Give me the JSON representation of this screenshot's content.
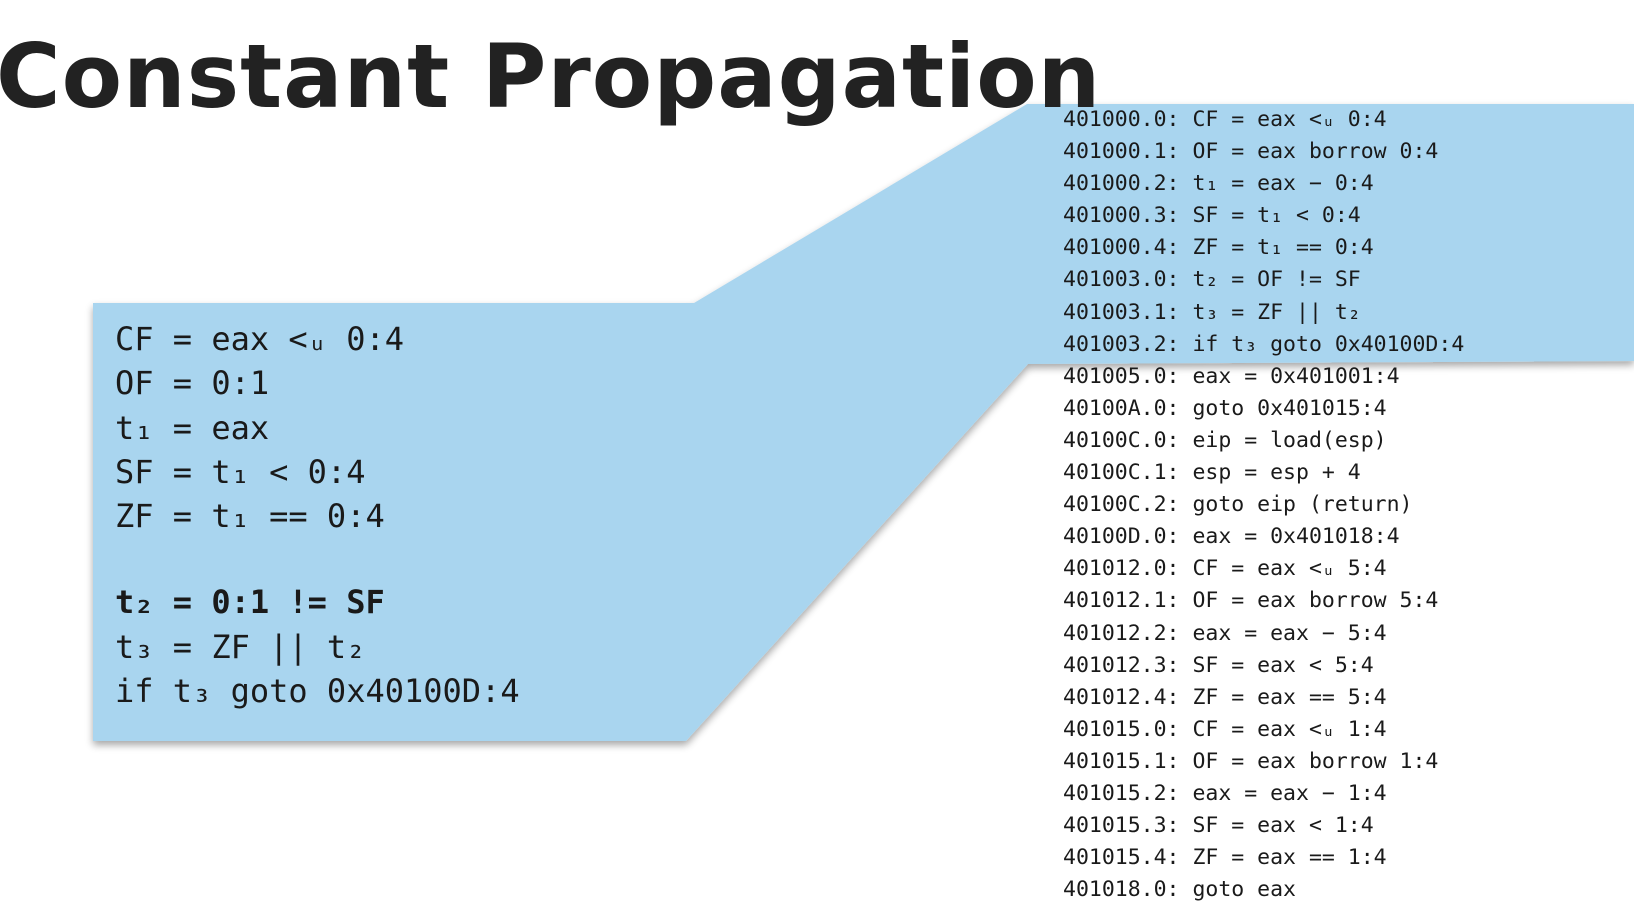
{
  "slide": {
    "title": "Constant Propagation"
  },
  "colors": {
    "callout_fill": "#a9d5ef",
    "text": "#1a1a1a",
    "title": "#222222"
  },
  "zoom_panel": {
    "lines": [
      "CF = eax <ᵤ 0:4",
      "OF = 0:1",
      "t₁ = eax",
      "SF = t₁ < 0:4",
      "ZF = t₁ == 0:4",
      "",
      "t₂ = 0:1 != SF",
      "t₃ = ZF || t₂",
      "if t₃ goto 0x40100D:4"
    ],
    "bold_line": "t₂ = 0:1 != SF"
  },
  "ir_listing": {
    "highlighted_range": "401000.0 – 401003.2",
    "lines": [
      "401000.0: CF = eax <ᵤ 0:4",
      "401000.1: OF = eax borrow 0:4",
      "401000.2: t₁ = eax − 0:4",
      "401000.3: SF = t₁ < 0:4",
      "401000.4: ZF = t₁ == 0:4",
      "401003.0: t₂ = OF != SF",
      "401003.1: t₃ = ZF || t₂",
      "401003.2: if t₃ goto 0x40100D:4",
      "401005.0: eax = 0x401001:4",
      "40100A.0: goto 0x401015:4",
      "40100C.0: eip = load(esp)",
      "40100C.1: esp = esp + 4",
      "40100C.2: goto eip (return)",
      "40100D.0: eax = 0x401018:4",
      "401012.0: CF = eax <ᵤ 5:4",
      "401012.1: OF = eax borrow 5:4",
      "401012.2: eax = eax − 5:4",
      "401012.3: SF = eax < 5:4",
      "401012.4: ZF = eax == 5:4",
      "401015.0: CF = eax <ᵤ 1:4",
      "401015.1: OF = eax borrow 1:4",
      "401015.2: eax = eax − 1:4",
      "401015.3: SF = eax < 1:4",
      "401015.4: ZF = eax == 1:4",
      "401018.0: goto eax"
    ]
  }
}
